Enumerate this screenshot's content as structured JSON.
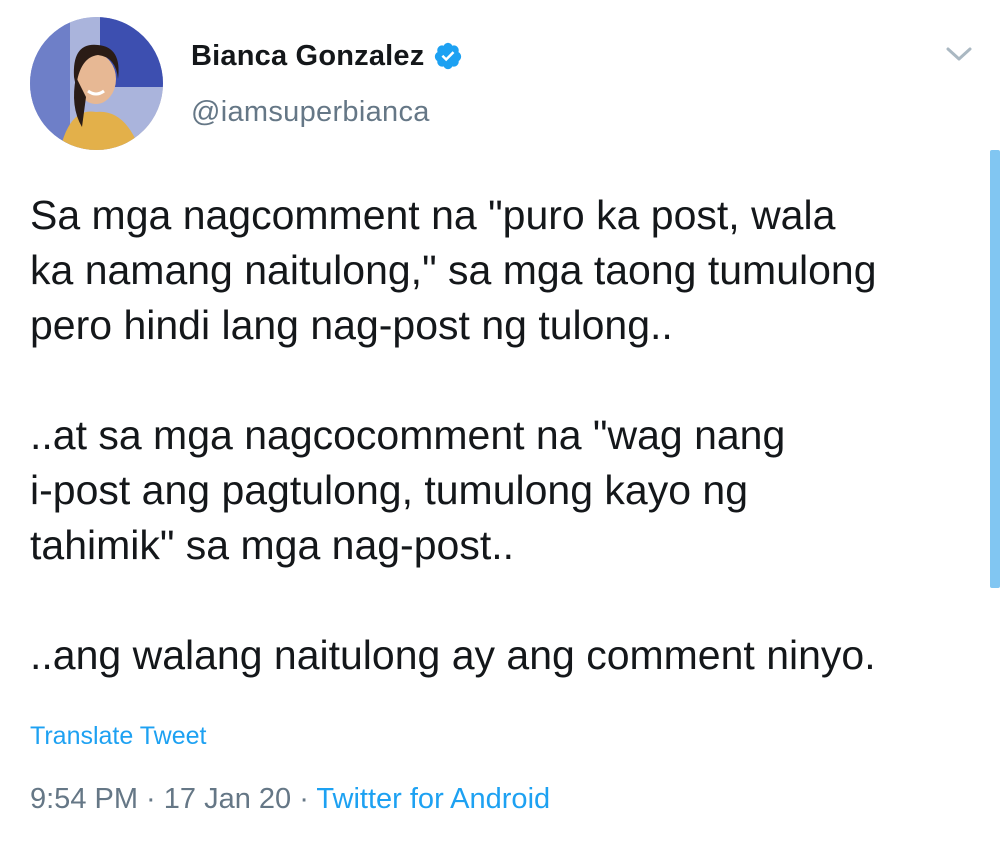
{
  "user": {
    "display_name": "Bianca Gonzalez",
    "handle": "@iamsuperbianca",
    "verified": true,
    "avatar_icon": "profile-photo"
  },
  "tweet": {
    "text": "Sa mga nagcomment na \"puro ka post, wala\nka namang naitulong,\" sa mga taong tumulong\npero hindi lang nag-post ng tulong..\n\n..at sa mga nagcocomment na \"wag nang\ni-post ang pagtulong, tumulong kayo ng\ntahimik\" sa mga nag-post..\n\n..ang walang naitulong ay ang comment ninyo.",
    "translate_label": "Translate Tweet",
    "time": "9:54 PM",
    "separator1": " · ",
    "date": "17 Jan 20",
    "separator2": " · ",
    "source": "Twitter for Android"
  },
  "colors": {
    "accent": "#1da1f2",
    "secondary_text": "#657786",
    "primary_text": "#14171a"
  },
  "icons": {
    "verified": "verified-badge-icon",
    "menu": "chevron-down-icon"
  }
}
